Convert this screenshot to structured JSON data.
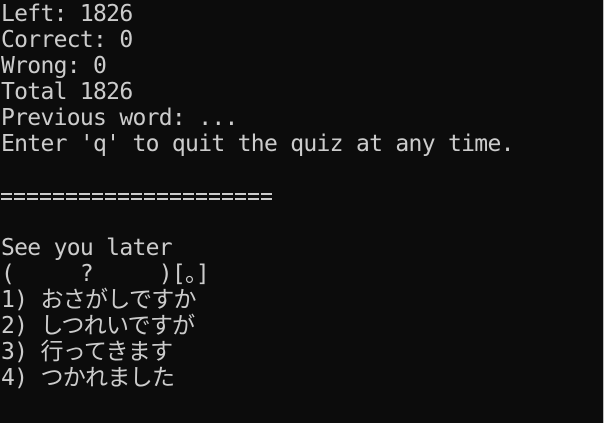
{
  "window": {
    "background": "#0c0c0c",
    "foreground": "#cccccc"
  },
  "stats": {
    "left": "Left: 1826",
    "correct": "Correct: 0",
    "wrong": "Wrong: 0",
    "total": "Total 1826",
    "previous_word": "Previous word: ...",
    "quit_hint": "Enter 'q' to quit the quiz at any time."
  },
  "separator": "=====================",
  "prompt": {
    "english": "See you later",
    "hint": "(     ?     )[。]"
  },
  "options": [
    "1) おさがしですか",
    "2) しつれいですが",
    "3) 行ってきます",
    "4) つかれました"
  ]
}
